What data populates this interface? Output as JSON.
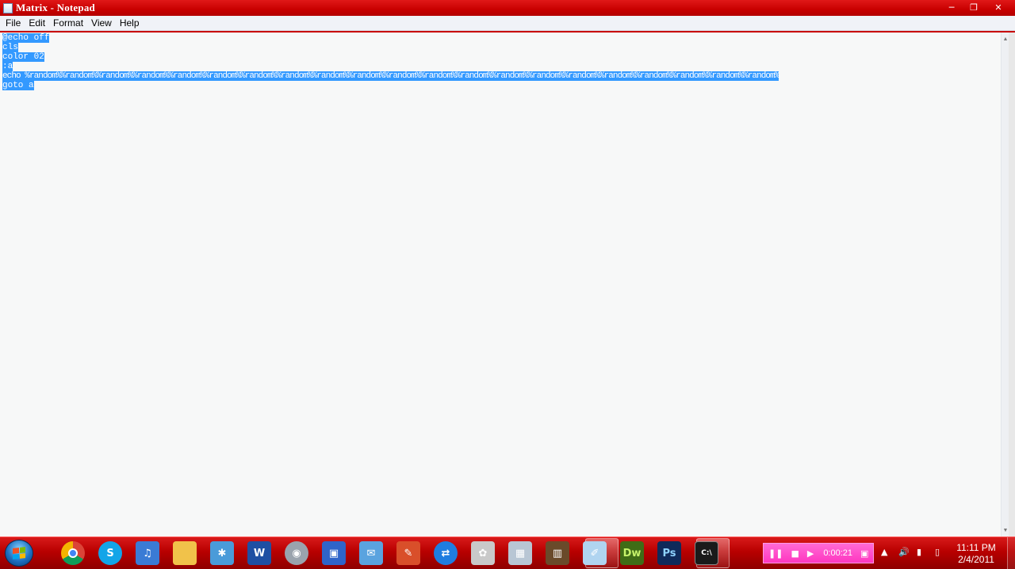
{
  "window": {
    "title": "Matrix - Notepad",
    "controls": {
      "minimize": "─",
      "maximize": "❐",
      "close": "✕"
    }
  },
  "menu": [
    "File",
    "Edit",
    "Format",
    "View",
    "Help"
  ],
  "editor": {
    "lines": [
      "@echo off",
      "cls",
      "color 02",
      ":a",
      "echo %random%%random%%random%%random%%random%%random%%random%%random%%random%%random%%random%%random%%random%%random%%random%%random%%random%%random%%random%%random%%random%",
      "goto a"
    ],
    "selection": "all"
  },
  "scrollbar": {
    "up": "▲",
    "down": "▼"
  },
  "taskbar": {
    "icons": [
      {
        "name": "chrome-icon",
        "glyph": "",
        "color": "#e8b400"
      },
      {
        "name": "skype-icon",
        "glyph": "S",
        "color": "#12a5e8"
      },
      {
        "name": "itunes-icon",
        "glyph": "♫",
        "color": "#3a7bd5"
      },
      {
        "name": "explorer-folder-icon",
        "glyph": "",
        "color": "#f1c24a"
      },
      {
        "name": "network-icon",
        "glyph": "✱",
        "color": "#4a9bd9"
      },
      {
        "name": "word-icon",
        "glyph": "W",
        "color": "#1e4fa3"
      },
      {
        "name": "webcam-icon",
        "glyph": "◉",
        "color": "#9aa3ad"
      },
      {
        "name": "remote-desktop-icon",
        "glyph": "▣",
        "color": "#2f64c9"
      },
      {
        "name": "mail-icon",
        "glyph": "✉",
        "color": "#5aa3df"
      },
      {
        "name": "paint-icon",
        "glyph": "✎",
        "color": "#d94f2a"
      },
      {
        "name": "teamviewer-icon",
        "glyph": "⇄",
        "color": "#1f7de0"
      },
      {
        "name": "media-icon",
        "glyph": "✿",
        "color": "#c9c9c9"
      },
      {
        "name": "calculator-icon",
        "glyph": "▦",
        "color": "#b8c6d4"
      },
      {
        "name": "archive-icon",
        "glyph": "▥",
        "color": "#6a4a2a"
      },
      {
        "name": "notepad-icon",
        "glyph": "✐",
        "color": "#b0d4f0"
      },
      {
        "name": "dreamweaver-icon",
        "glyph": "Dw",
        "color": "#3f6c16"
      },
      {
        "name": "photoshop-icon",
        "glyph": "Ps",
        "color": "#0f2a5a"
      },
      {
        "name": "cmd-icon",
        "glyph": "C:\\",
        "color": "#1a1a1a"
      }
    ]
  },
  "recorder": {
    "pause": "❚❚",
    "stop": "■",
    "play": "▶",
    "time": "0:00:21",
    "menu": "▣"
  },
  "tray": {
    "arrow": "▲",
    "volume": "🔊",
    "signal": "▮",
    "battery": "▯"
  },
  "clock": {
    "time": "11:11 PM",
    "date": "2/4/2011"
  }
}
